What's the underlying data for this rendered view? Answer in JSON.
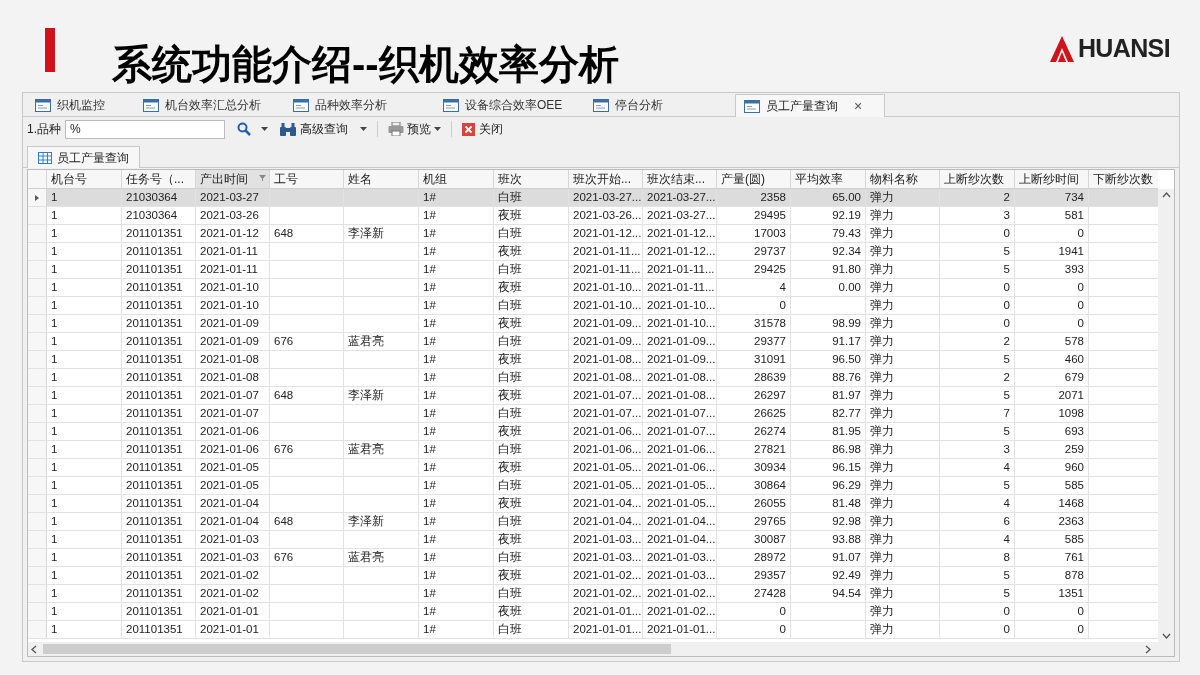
{
  "slide": {
    "title": "系统功能介绍--织机效率分析",
    "logo": "HUANSI"
  },
  "tabs": [
    {
      "label": "织机监控",
      "selected": false
    },
    {
      "label": "机台效率汇总分析",
      "selected": false
    },
    {
      "label": "品种效率分析",
      "selected": false
    },
    {
      "label": "设备综合效率OEE",
      "selected": false
    },
    {
      "label": "停台分析",
      "selected": false
    },
    {
      "label": "员工产量查询",
      "selected": true,
      "close": "×"
    }
  ],
  "toolbar": {
    "filter_label": "1.品种",
    "filter_value": "%",
    "advanced_query": "高级查询",
    "preview": "预览",
    "close": "关闭"
  },
  "subtabs": [
    {
      "label": "员工产量查询",
      "selected": true
    }
  ],
  "table": {
    "columns": [
      {
        "label": "机台号",
        "sorted": false
      },
      {
        "label": "任务号（...",
        "sorted": false
      },
      {
        "label": "产出时间",
        "sorted": true
      },
      {
        "label": "工号",
        "sorted": false
      },
      {
        "label": "姓名",
        "sorted": false
      },
      {
        "label": "机组",
        "sorted": false
      },
      {
        "label": "班次",
        "sorted": false
      },
      {
        "label": "班次开始...",
        "sorted": false
      },
      {
        "label": "班次结束...",
        "sorted": false
      },
      {
        "label": "产量(圆)",
        "sorted": false
      },
      {
        "label": "平均效率",
        "sorted": false
      },
      {
        "label": "物料名称",
        "sorted": false
      },
      {
        "label": "上断纱次数",
        "sorted": false
      },
      {
        "label": "上断纱时间",
        "sorted": false
      },
      {
        "label": "下断纱次数",
        "sorted": false
      }
    ],
    "rows": [
      {
        "selected": true,
        "cells": [
          "1",
          "21030364",
          "2021-03-27",
          "",
          "",
          "1#",
          "白班",
          "2021-03-27...",
          "2021-03-27...",
          "2358",
          "65.00",
          "弹力",
          "2",
          "734"
        ]
      },
      {
        "selected": false,
        "cells": [
          "1",
          "21030364",
          "2021-03-26",
          "",
          "",
          "1#",
          "夜班",
          "2021-03-26...",
          "2021-03-27...",
          "29495",
          "92.19",
          "弹力",
          "3",
          "581"
        ]
      },
      {
        "selected": false,
        "cells": [
          "1",
          "201101351",
          "2021-01-12",
          "648",
          "李泽新",
          "1#",
          "白班",
          "2021-01-12...",
          "2021-01-12...",
          "17003",
          "79.43",
          "弹力",
          "0",
          "0"
        ]
      },
      {
        "selected": false,
        "cells": [
          "1",
          "201101351",
          "2021-01-11",
          "",
          "",
          "1#",
          "夜班",
          "2021-01-11...",
          "2021-01-12...",
          "29737",
          "92.34",
          "弹力",
          "5",
          "1941"
        ]
      },
      {
        "selected": false,
        "cells": [
          "1",
          "201101351",
          "2021-01-11",
          "",
          "",
          "1#",
          "白班",
          "2021-01-11...",
          "2021-01-11...",
          "29425",
          "91.80",
          "弹力",
          "5",
          "393"
        ]
      },
      {
        "selected": false,
        "cells": [
          "1",
          "201101351",
          "2021-01-10",
          "",
          "",
          "1#",
          "夜班",
          "2021-01-10...",
          "2021-01-11...",
          "4",
          "0.00",
          "弹力",
          "0",
          "0"
        ]
      },
      {
        "selected": false,
        "cells": [
          "1",
          "201101351",
          "2021-01-10",
          "",
          "",
          "1#",
          "白班",
          "2021-01-10...",
          "2021-01-10...",
          "0",
          "",
          "弹力",
          "0",
          "0"
        ]
      },
      {
        "selected": false,
        "cells": [
          "1",
          "201101351",
          "2021-01-09",
          "",
          "",
          "1#",
          "夜班",
          "2021-01-09...",
          "2021-01-10...",
          "31578",
          "98.99",
          "弹力",
          "0",
          "0"
        ]
      },
      {
        "selected": false,
        "cells": [
          "1",
          "201101351",
          "2021-01-09",
          "676",
          "蓝君亮",
          "1#",
          "白班",
          "2021-01-09...",
          "2021-01-09...",
          "29377",
          "91.17",
          "弹力",
          "2",
          "578"
        ]
      },
      {
        "selected": false,
        "cells": [
          "1",
          "201101351",
          "2021-01-08",
          "",
          "",
          "1#",
          "夜班",
          "2021-01-08...",
          "2021-01-09...",
          "31091",
          "96.50",
          "弹力",
          "5",
          "460"
        ]
      },
      {
        "selected": false,
        "cells": [
          "1",
          "201101351",
          "2021-01-08",
          "",
          "",
          "1#",
          "白班",
          "2021-01-08...",
          "2021-01-08...",
          "28639",
          "88.76",
          "弹力",
          "2",
          "679"
        ]
      },
      {
        "selected": false,
        "cells": [
          "1",
          "201101351",
          "2021-01-07",
          "648",
          "李泽新",
          "1#",
          "夜班",
          "2021-01-07...",
          "2021-01-08...",
          "26297",
          "81.97",
          "弹力",
          "5",
          "2071"
        ]
      },
      {
        "selected": false,
        "cells": [
          "1",
          "201101351",
          "2021-01-07",
          "",
          "",
          "1#",
          "白班",
          "2021-01-07...",
          "2021-01-07...",
          "26625",
          "82.77",
          "弹力",
          "7",
          "1098"
        ]
      },
      {
        "selected": false,
        "cells": [
          "1",
          "201101351",
          "2021-01-06",
          "",
          "",
          "1#",
          "夜班",
          "2021-01-06...",
          "2021-01-07...",
          "26274",
          "81.95",
          "弹力",
          "5",
          "693"
        ]
      },
      {
        "selected": false,
        "cells": [
          "1",
          "201101351",
          "2021-01-06",
          "676",
          "蓝君亮",
          "1#",
          "白班",
          "2021-01-06...",
          "2021-01-06...",
          "27821",
          "86.98",
          "弹力",
          "3",
          "259"
        ]
      },
      {
        "selected": false,
        "cells": [
          "1",
          "201101351",
          "2021-01-05",
          "",
          "",
          "1#",
          "夜班",
          "2021-01-05...",
          "2021-01-06...",
          "30934",
          "96.15",
          "弹力",
          "4",
          "960"
        ]
      },
      {
        "selected": false,
        "cells": [
          "1",
          "201101351",
          "2021-01-05",
          "",
          "",
          "1#",
          "白班",
          "2021-01-05...",
          "2021-01-05...",
          "30864",
          "96.29",
          "弹力",
          "5",
          "585"
        ]
      },
      {
        "selected": false,
        "cells": [
          "1",
          "201101351",
          "2021-01-04",
          "",
          "",
          "1#",
          "夜班",
          "2021-01-04...",
          "2021-01-05...",
          "26055",
          "81.48",
          "弹力",
          "4",
          "1468"
        ]
      },
      {
        "selected": false,
        "cells": [
          "1",
          "201101351",
          "2021-01-04",
          "648",
          "李泽新",
          "1#",
          "白班",
          "2021-01-04...",
          "2021-01-04...",
          "29765",
          "92.98",
          "弹力",
          "6",
          "2363"
        ]
      },
      {
        "selected": false,
        "cells": [
          "1",
          "201101351",
          "2021-01-03",
          "",
          "",
          "1#",
          "夜班",
          "2021-01-03...",
          "2021-01-04...",
          "30087",
          "93.88",
          "弹力",
          "4",
          "585"
        ]
      },
      {
        "selected": false,
        "cells": [
          "1",
          "201101351",
          "2021-01-03",
          "676",
          "蓝君亮",
          "1#",
          "白班",
          "2021-01-03...",
          "2021-01-03...",
          "28972",
          "91.07",
          "弹力",
          "8",
          "761"
        ]
      },
      {
        "selected": false,
        "cells": [
          "1",
          "201101351",
          "2021-01-02",
          "",
          "",
          "1#",
          "夜班",
          "2021-01-02...",
          "2021-01-03...",
          "29357",
          "92.49",
          "弹力",
          "5",
          "878"
        ]
      },
      {
        "selected": false,
        "cells": [
          "1",
          "201101351",
          "2021-01-02",
          "",
          "",
          "1#",
          "白班",
          "2021-01-02...",
          "2021-01-02...",
          "27428",
          "94.54",
          "弹力",
          "5",
          "1351"
        ]
      },
      {
        "selected": false,
        "cells": [
          "1",
          "201101351",
          "2021-01-01",
          "",
          "",
          "1#",
          "夜班",
          "2021-01-01...",
          "2021-01-02...",
          "0",
          "",
          "弹力",
          "0",
          "0"
        ]
      },
      {
        "selected": false,
        "cells": [
          "1",
          "201101351",
          "2021-01-01",
          "",
          "",
          "1#",
          "白班",
          "2021-01-01...",
          "2021-01-01...",
          "0",
          "",
          "弹力",
          "0",
          "0"
        ]
      }
    ]
  }
}
